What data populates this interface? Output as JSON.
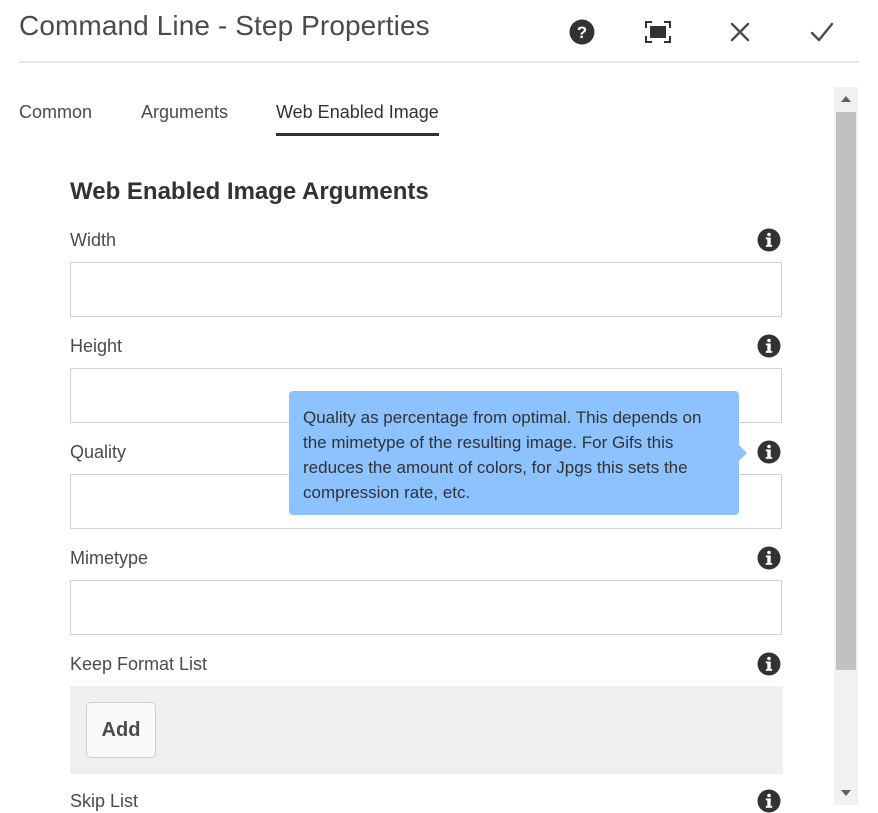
{
  "dialog": {
    "title": "Command Line - Step Properties",
    "actions": {
      "help_icon": "help-icon",
      "fullscreen_icon": "fullscreen-icon",
      "close_icon": "close-icon",
      "done_icon": "checkmark-icon"
    }
  },
  "tabs": [
    {
      "label": "Common",
      "selected": false
    },
    {
      "label": "Arguments",
      "selected": false
    },
    {
      "label": "Web Enabled Image",
      "selected": true
    }
  ],
  "section": {
    "title": "Web Enabled Image Arguments",
    "fields": [
      {
        "label": "Width",
        "value": "",
        "info_icon": "info-icon"
      },
      {
        "label": "Height",
        "value": "",
        "info_icon": "info-icon"
      },
      {
        "label": "Quality",
        "value": "",
        "info_icon": "info-icon"
      },
      {
        "label": "Mimetype",
        "value": "",
        "info_icon": "info-icon"
      }
    ],
    "keep_format_list": {
      "label": "Keep Format List",
      "add_label": "Add",
      "info_icon": "info-icon"
    },
    "skip_list": {
      "label": "Skip List",
      "info_icon": "info-icon"
    }
  },
  "tooltip": {
    "text": "Quality as percentage from optimal. This depends on the mimetype of the resulting image. For Gifs this reduces the amount of colors, for Jpgs this sets the compression rate, etc."
  },
  "colors": {
    "tooltip_bg": "#8cc2ff",
    "active_tab_underline": "#323232",
    "icon": "#323232"
  }
}
